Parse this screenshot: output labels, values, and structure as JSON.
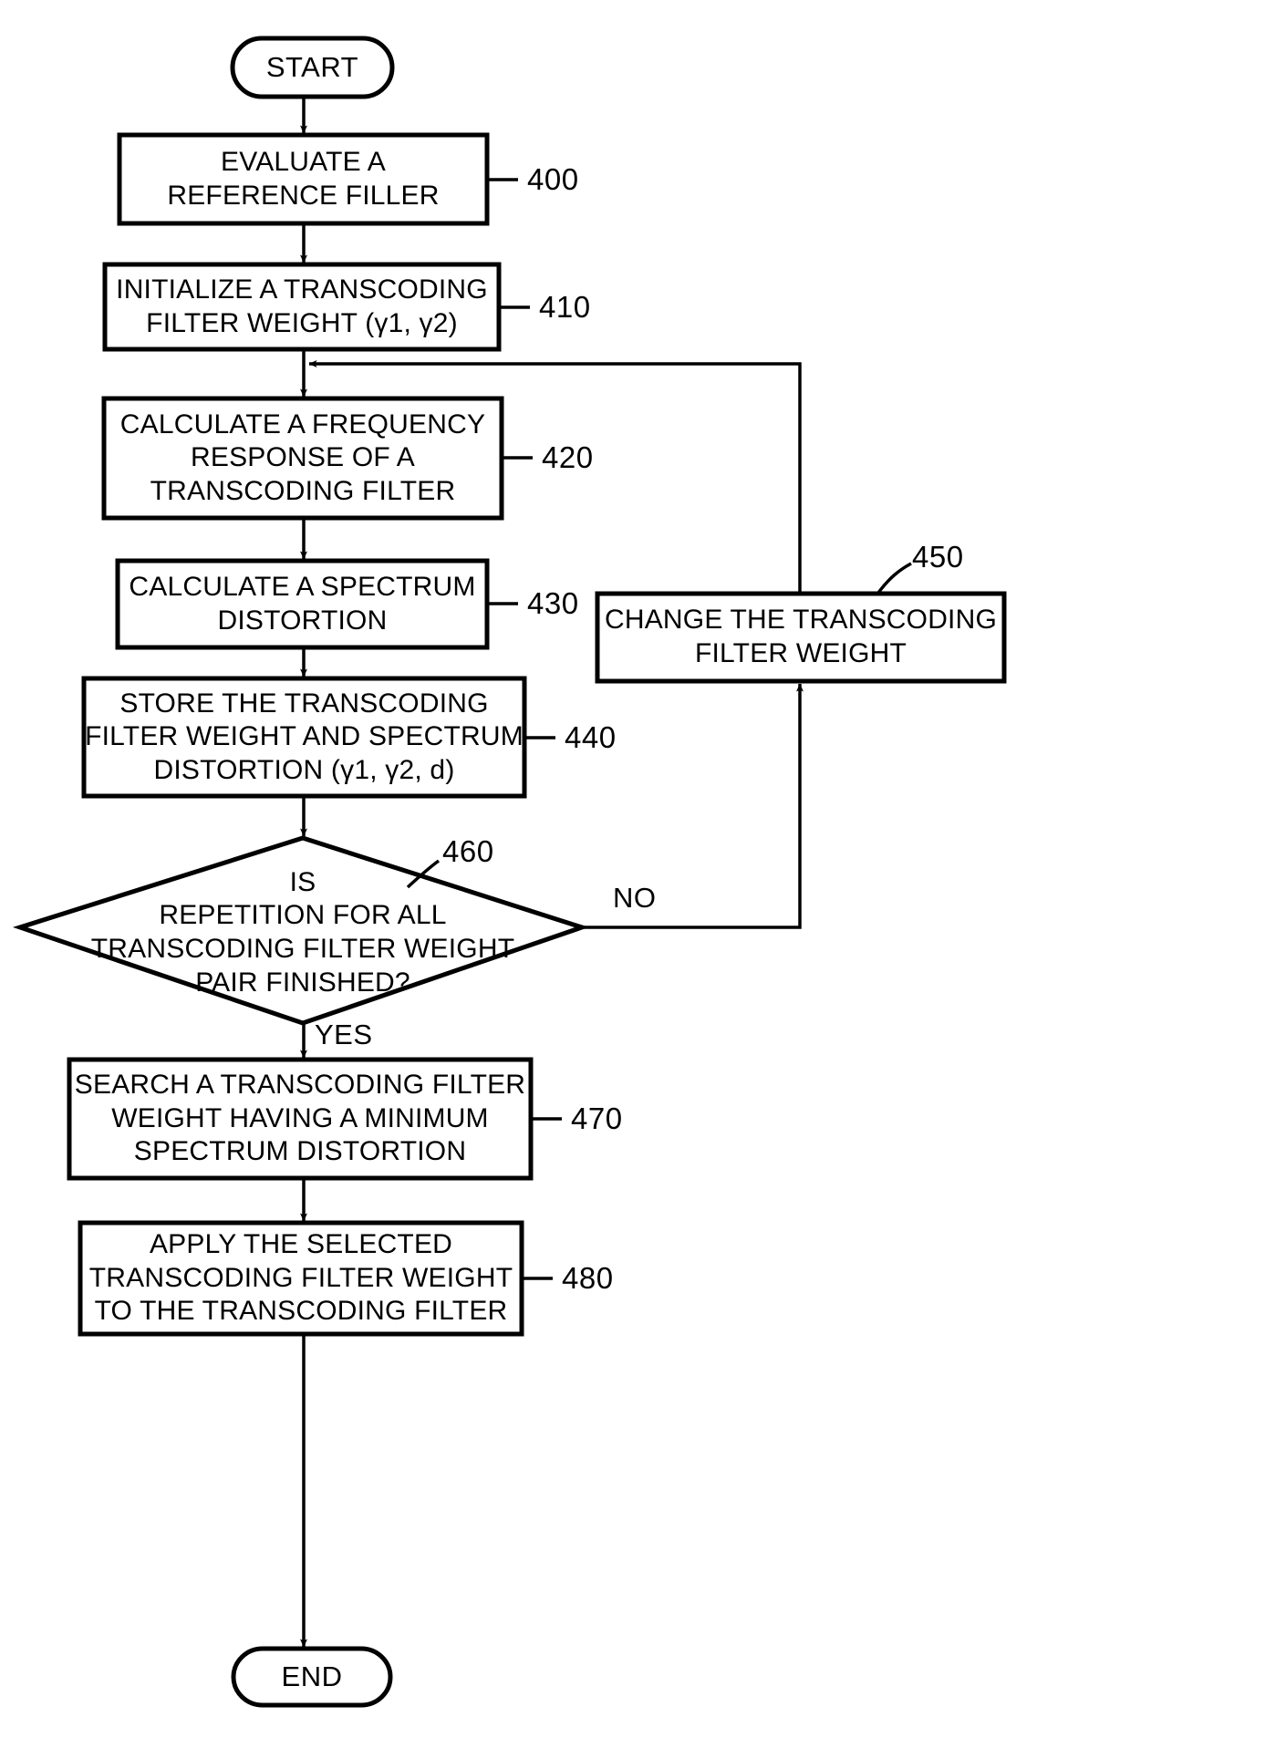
{
  "diagram": {
    "type": "flowchart",
    "nodes": [
      {
        "id": "start",
        "shape": "terminator",
        "lines": [
          "START"
        ]
      },
      {
        "id": "n400",
        "shape": "process",
        "ref": "400",
        "lines": [
          "EVALUATE A",
          "REFERENCE FILLER"
        ]
      },
      {
        "id": "n410",
        "shape": "process",
        "ref": "410",
        "lines": [
          "INITIALIZE A TRANSCODING",
          "FILTER WEIGHT (γ1, γ2)"
        ]
      },
      {
        "id": "n420",
        "shape": "process",
        "ref": "420",
        "lines": [
          "CALCULATE A FREQUENCY",
          "RESPONSE OF A",
          "TRANSCODING FILTER"
        ]
      },
      {
        "id": "n430",
        "shape": "process",
        "ref": "430",
        "lines": [
          "CALCULATE A SPECTRUM",
          "DISTORTION"
        ]
      },
      {
        "id": "n440",
        "shape": "process",
        "ref": "440",
        "lines": [
          "STORE THE TRANSCODING",
          "FILTER WEIGHT AND SPECTRUM",
          "DISTORTION (γ1, γ2, d)"
        ]
      },
      {
        "id": "n450",
        "shape": "process",
        "ref": "450",
        "lines": [
          "CHANGE THE TRANSCODING",
          "FILTER WEIGHT"
        ]
      },
      {
        "id": "n460",
        "shape": "decision",
        "ref": "460",
        "lines": [
          "IS",
          "REPETITION FOR ALL",
          "TRANSCODING FILTER WEIGHT",
          "PAIR FINISHED?"
        ]
      },
      {
        "id": "n470",
        "shape": "process",
        "ref": "470",
        "lines": [
          "SEARCH A TRANSCODING FILTER",
          "WEIGHT HAVING A MINIMUM",
          "SPECTRUM DISTORTION"
        ]
      },
      {
        "id": "n480",
        "shape": "process",
        "ref": "480",
        "lines": [
          "APPLY THE SELECTED",
          "TRANSCODING FILTER WEIGHT",
          "TO THE TRANSCODING FILTER"
        ]
      },
      {
        "id": "end",
        "shape": "terminator",
        "lines": [
          "END"
        ]
      }
    ],
    "edge_labels": {
      "no": "NO",
      "yes": "YES"
    },
    "refs": {
      "r400": "400",
      "r410": "410",
      "r420": "420",
      "r430": "430",
      "r440": "440",
      "r450": "450",
      "r460": "460",
      "r470": "470",
      "r480": "480"
    },
    "colors": {
      "stroke": "#000000",
      "fill": "#ffffff",
      "text": "#000000"
    }
  }
}
